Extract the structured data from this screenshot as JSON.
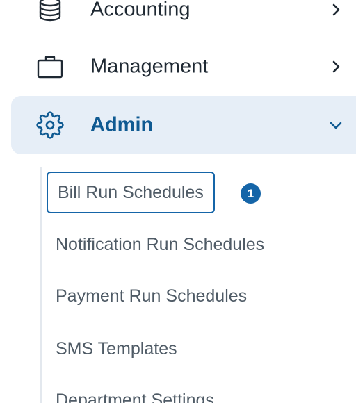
{
  "nav": {
    "accounting": {
      "label": "Accounting",
      "icon": "database-icon",
      "chevron": "chevron-right-icon"
    },
    "management": {
      "label": "Management",
      "icon": "briefcase-icon",
      "chevron": "chevron-right-icon"
    },
    "admin": {
      "label": "Admin",
      "icon": "gear-icon",
      "chevron": "chevron-down-icon",
      "expanded": true
    }
  },
  "submenu": {
    "items": [
      {
        "label": "Bill Run Schedules",
        "focused": true
      },
      {
        "label": "Notification Run Schedules"
      },
      {
        "label": "Payment Run Schedules"
      },
      {
        "label": "SMS Templates"
      },
      {
        "label": "Department Settings"
      }
    ],
    "badge": "1"
  },
  "colors": {
    "accent": "#1565a8",
    "active_text": "#0f5a92",
    "active_bg": "#e6eef7",
    "sub_text": "#4f5b66"
  }
}
